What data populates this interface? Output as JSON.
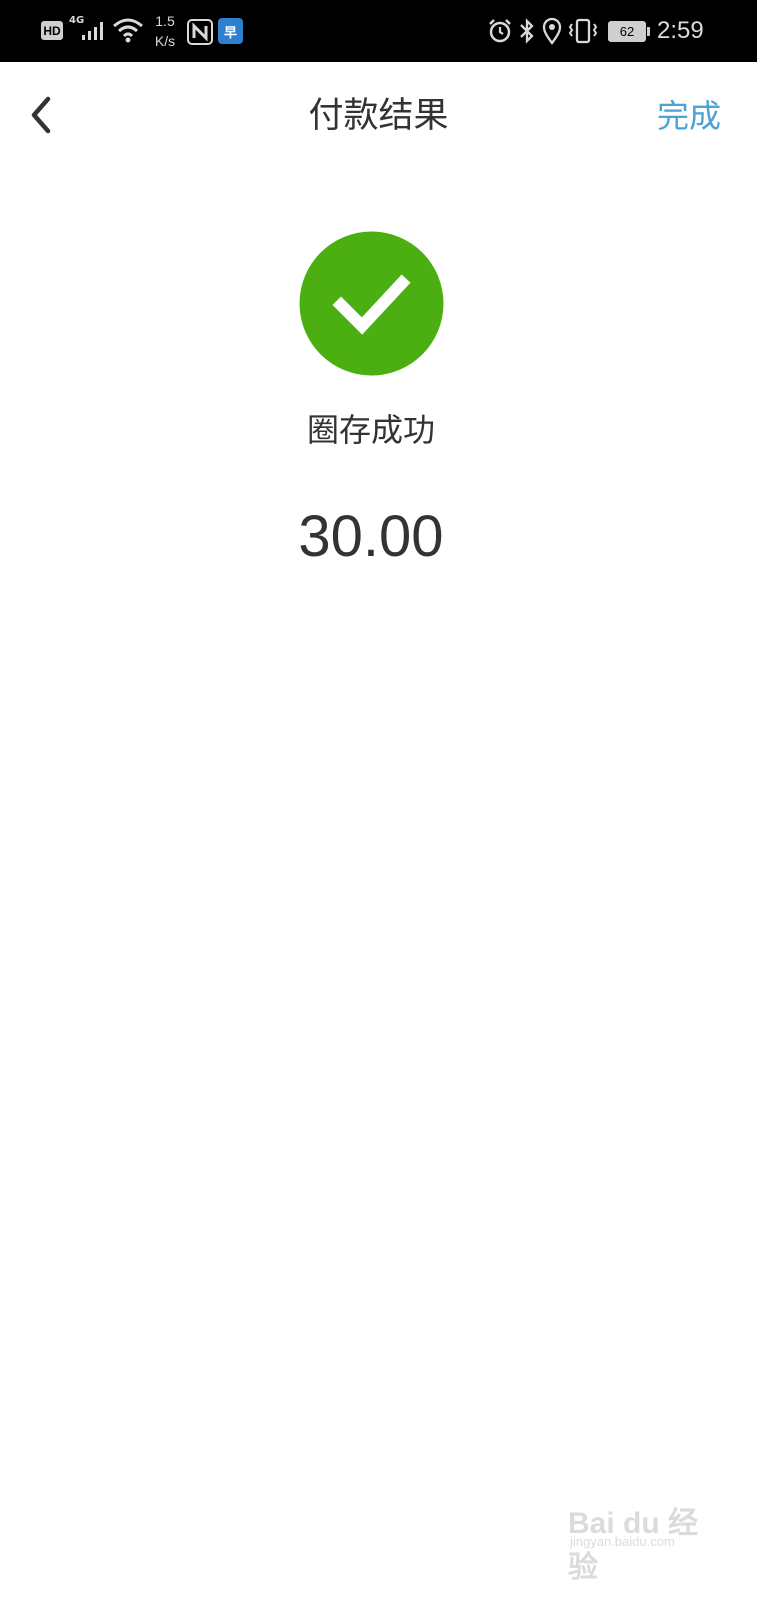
{
  "status_bar": {
    "hd": "HD",
    "network": "4G",
    "speed_value": "1.5",
    "speed_unit": "K/s",
    "app_badge": "早",
    "battery": "62",
    "time": "2:59"
  },
  "nav": {
    "title": "付款结果",
    "done_label": "完成"
  },
  "result": {
    "status_text": "圈存成功",
    "amount": "30.00",
    "success_color": "#4caf11"
  },
  "watermark": {
    "main": "Bai du 经验",
    "sub": "jingyan.baidu.com"
  }
}
